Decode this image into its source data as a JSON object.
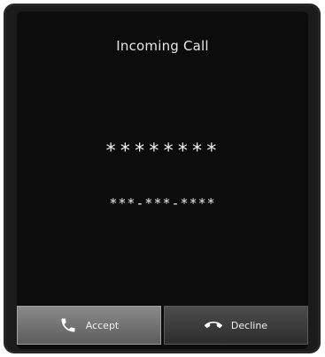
{
  "call": {
    "title": "Incoming Call",
    "caller_name": "********",
    "caller_number": "***-***-****"
  },
  "actions": {
    "accept_label": "Accept",
    "accept_icon": "phone-accept-icon",
    "decline_label": "Decline",
    "decline_icon": "phone-hangup-icon"
  },
  "colors": {
    "background": "#0c0c0c",
    "accept_button": "#6f6f6f",
    "decline_button": "#3a3a3a",
    "text": "#ffffff"
  }
}
